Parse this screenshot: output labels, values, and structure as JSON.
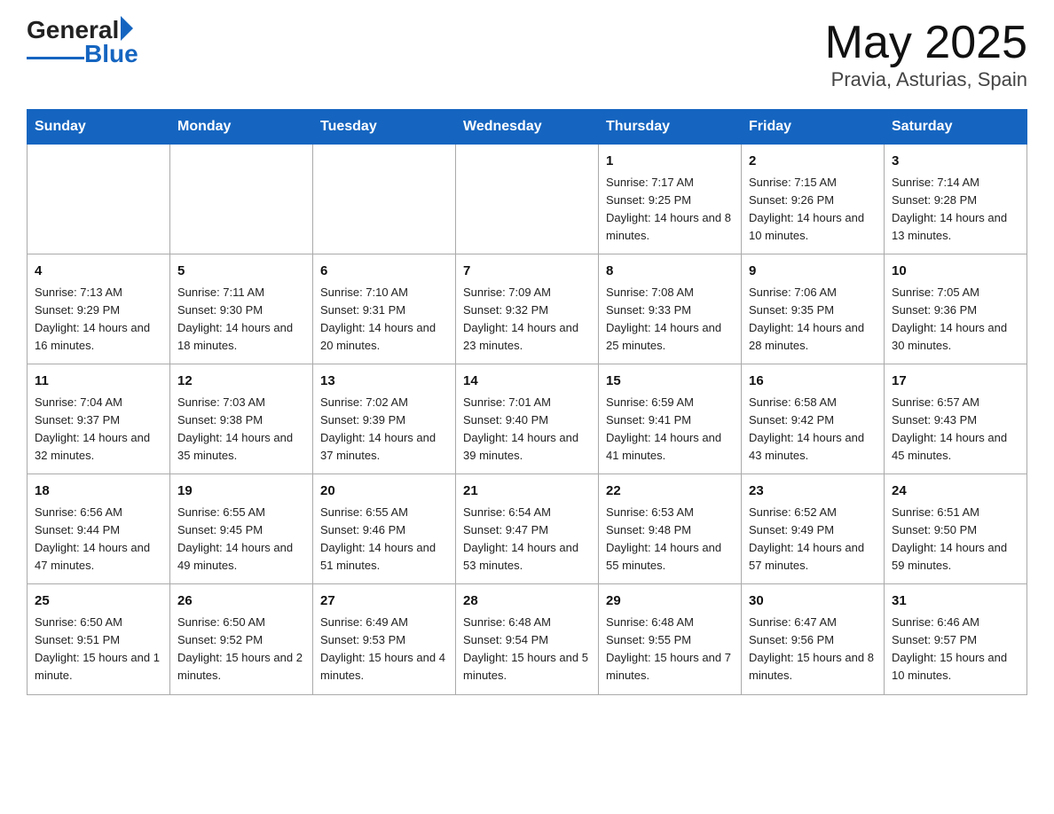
{
  "header": {
    "logo_general": "General",
    "logo_blue": "Blue",
    "title": "May 2025",
    "location": "Pravia, Asturias, Spain"
  },
  "days_of_week": [
    "Sunday",
    "Monday",
    "Tuesday",
    "Wednesday",
    "Thursday",
    "Friday",
    "Saturday"
  ],
  "weeks": [
    [
      {
        "day": "",
        "info": ""
      },
      {
        "day": "",
        "info": ""
      },
      {
        "day": "",
        "info": ""
      },
      {
        "day": "",
        "info": ""
      },
      {
        "day": "1",
        "info": "Sunrise: 7:17 AM\nSunset: 9:25 PM\nDaylight: 14 hours and 8 minutes."
      },
      {
        "day": "2",
        "info": "Sunrise: 7:15 AM\nSunset: 9:26 PM\nDaylight: 14 hours and 10 minutes."
      },
      {
        "day": "3",
        "info": "Sunrise: 7:14 AM\nSunset: 9:28 PM\nDaylight: 14 hours and 13 minutes."
      }
    ],
    [
      {
        "day": "4",
        "info": "Sunrise: 7:13 AM\nSunset: 9:29 PM\nDaylight: 14 hours and 16 minutes."
      },
      {
        "day": "5",
        "info": "Sunrise: 7:11 AM\nSunset: 9:30 PM\nDaylight: 14 hours and 18 minutes."
      },
      {
        "day": "6",
        "info": "Sunrise: 7:10 AM\nSunset: 9:31 PM\nDaylight: 14 hours and 20 minutes."
      },
      {
        "day": "7",
        "info": "Sunrise: 7:09 AM\nSunset: 9:32 PM\nDaylight: 14 hours and 23 minutes."
      },
      {
        "day": "8",
        "info": "Sunrise: 7:08 AM\nSunset: 9:33 PM\nDaylight: 14 hours and 25 minutes."
      },
      {
        "day": "9",
        "info": "Sunrise: 7:06 AM\nSunset: 9:35 PM\nDaylight: 14 hours and 28 minutes."
      },
      {
        "day": "10",
        "info": "Sunrise: 7:05 AM\nSunset: 9:36 PM\nDaylight: 14 hours and 30 minutes."
      }
    ],
    [
      {
        "day": "11",
        "info": "Sunrise: 7:04 AM\nSunset: 9:37 PM\nDaylight: 14 hours and 32 minutes."
      },
      {
        "day": "12",
        "info": "Sunrise: 7:03 AM\nSunset: 9:38 PM\nDaylight: 14 hours and 35 minutes."
      },
      {
        "day": "13",
        "info": "Sunrise: 7:02 AM\nSunset: 9:39 PM\nDaylight: 14 hours and 37 minutes."
      },
      {
        "day": "14",
        "info": "Sunrise: 7:01 AM\nSunset: 9:40 PM\nDaylight: 14 hours and 39 minutes."
      },
      {
        "day": "15",
        "info": "Sunrise: 6:59 AM\nSunset: 9:41 PM\nDaylight: 14 hours and 41 minutes."
      },
      {
        "day": "16",
        "info": "Sunrise: 6:58 AM\nSunset: 9:42 PM\nDaylight: 14 hours and 43 minutes."
      },
      {
        "day": "17",
        "info": "Sunrise: 6:57 AM\nSunset: 9:43 PM\nDaylight: 14 hours and 45 minutes."
      }
    ],
    [
      {
        "day": "18",
        "info": "Sunrise: 6:56 AM\nSunset: 9:44 PM\nDaylight: 14 hours and 47 minutes."
      },
      {
        "day": "19",
        "info": "Sunrise: 6:55 AM\nSunset: 9:45 PM\nDaylight: 14 hours and 49 minutes."
      },
      {
        "day": "20",
        "info": "Sunrise: 6:55 AM\nSunset: 9:46 PM\nDaylight: 14 hours and 51 minutes."
      },
      {
        "day": "21",
        "info": "Sunrise: 6:54 AM\nSunset: 9:47 PM\nDaylight: 14 hours and 53 minutes."
      },
      {
        "day": "22",
        "info": "Sunrise: 6:53 AM\nSunset: 9:48 PM\nDaylight: 14 hours and 55 minutes."
      },
      {
        "day": "23",
        "info": "Sunrise: 6:52 AM\nSunset: 9:49 PM\nDaylight: 14 hours and 57 minutes."
      },
      {
        "day": "24",
        "info": "Sunrise: 6:51 AM\nSunset: 9:50 PM\nDaylight: 14 hours and 59 minutes."
      }
    ],
    [
      {
        "day": "25",
        "info": "Sunrise: 6:50 AM\nSunset: 9:51 PM\nDaylight: 15 hours and 1 minute."
      },
      {
        "day": "26",
        "info": "Sunrise: 6:50 AM\nSunset: 9:52 PM\nDaylight: 15 hours and 2 minutes."
      },
      {
        "day": "27",
        "info": "Sunrise: 6:49 AM\nSunset: 9:53 PM\nDaylight: 15 hours and 4 minutes."
      },
      {
        "day": "28",
        "info": "Sunrise: 6:48 AM\nSunset: 9:54 PM\nDaylight: 15 hours and 5 minutes."
      },
      {
        "day": "29",
        "info": "Sunrise: 6:48 AM\nSunset: 9:55 PM\nDaylight: 15 hours and 7 minutes."
      },
      {
        "day": "30",
        "info": "Sunrise: 6:47 AM\nSunset: 9:56 PM\nDaylight: 15 hours and 8 minutes."
      },
      {
        "day": "31",
        "info": "Sunrise: 6:46 AM\nSunset: 9:57 PM\nDaylight: 15 hours and 10 minutes."
      }
    ]
  ]
}
